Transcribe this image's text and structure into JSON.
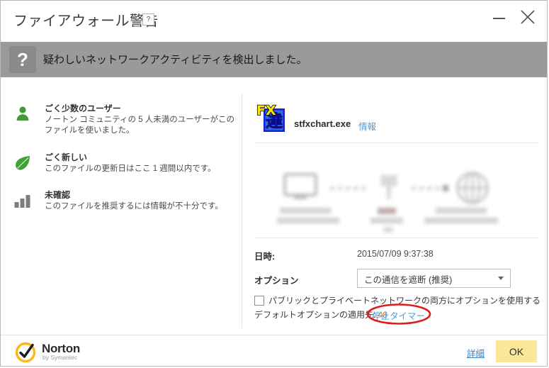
{
  "window": {
    "title": "ファイアウォール警告",
    "help_button": "?",
    "minimize_label": "最小化",
    "close_label": "閉じる"
  },
  "banner": {
    "icon": "?",
    "message": "疑わしいネットワークアクティビティを検出しました。"
  },
  "reputation": {
    "items": [
      {
        "icon": "user-icon",
        "title": "ごく少数のユーザー",
        "description": "ノートン コミュニティの 5 人未満のユーザーがこのファイルを使いました。"
      },
      {
        "icon": "leaf-icon",
        "title": "ごく新しい",
        "description": "このファイルの更新日はここ 1 週間以内です。"
      },
      {
        "icon": "bar-chart-icon",
        "title": "未確認",
        "description": "このファイルを推奨するには情報が不十分です。"
      }
    ]
  },
  "file": {
    "icon_top_text": "FX",
    "icon_kanji": "達",
    "name": "stfxchart.exe",
    "info_link": "情報"
  },
  "network_diagram": {
    "nodes": [
      "computer-icon",
      "router-icon",
      "globe-icon"
    ],
    "labels_redacted": true
  },
  "fields": {
    "date_label": "日時:",
    "date_value": "2015/07/09 9:37:38",
    "option_label": "オプション",
    "option_selected": "この通信を遮断 (推奨)",
    "checkbox_label": "パブリックとプライベートネットワークの両方にオプションを使用する",
    "checkbox_checked": false,
    "default_option_prefix": "デフォルトオプションの適用先: ",
    "default_option_countdown": "48",
    "stop_timer_link": "停止タイマー"
  },
  "footer": {
    "brand_name": "Norton",
    "brand_sub": "by Symantec",
    "detail_link": "詳細",
    "ok_label": "OK"
  },
  "colors": {
    "banner_bg": "#9a9a9a",
    "accent_green": "#3f9c35",
    "link_blue": "#4a9fd8",
    "ok_button": "#fae79a",
    "annotation_red": "#e01b1b",
    "countdown_orange": "#d07a22"
  }
}
